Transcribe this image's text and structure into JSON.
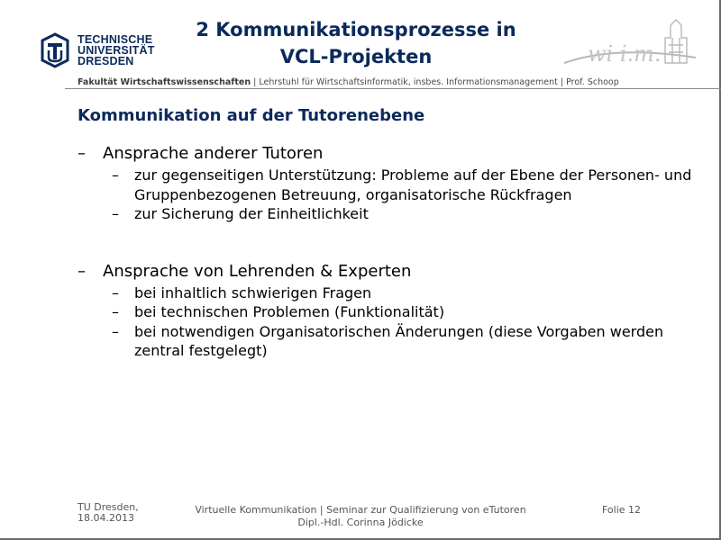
{
  "logo": {
    "line1": "TECHNISCHE",
    "line2": "UNIVERSITÄT",
    "line3": "DRESDEN",
    "icon": "tu-dresden-logo"
  },
  "title": {
    "line1": "2 Kommunikationsprozesse in",
    "line2": "VCL-Projekten"
  },
  "right_logo": {
    "icon": "wiim-logo",
    "text": "wi i.m."
  },
  "faculty": {
    "bold": "Fakultät Wirtschaftswissenschaften",
    "rest": " | Lehrstuhl für Wirtschaftsinformatik, insbes. Informationsmanagement | Prof. Schoop"
  },
  "heading": "Kommunikation auf der Tutorenebene",
  "sections": [
    {
      "label": "Ansprache anderer Tutoren",
      "items": [
        "zur gegenseitigen Unterstützung: Probleme auf der Ebene der Personen- und Gruppenbezogenen Betreuung, organisatorische Rückfragen",
        "zur Sicherung der Einheitlichkeit"
      ]
    },
    {
      "label": "Ansprache von Lehrenden & Experten",
      "items": [
        "bei inhaltlich schwierigen Fragen",
        "bei technischen Problemen (Funktionalität)",
        "bei notwendigen Organisatorischen Änderungen (diese Vorgaben werden zentral festgelegt)"
      ]
    }
  ],
  "dash": "–",
  "footer": {
    "left_line1": "TU Dresden,",
    "left_line2": "18.04.2013",
    "mid_line1": "Virtuelle Kommunikation | Seminar zur Qualifizierung von eTutoren",
    "mid_line2": "Dipl.-Hdl. Corinna Jödicke",
    "right": "Folie 12"
  },
  "colors": {
    "primary": "#0b2a5b",
    "text": "#000000",
    "muted": "#555555"
  }
}
